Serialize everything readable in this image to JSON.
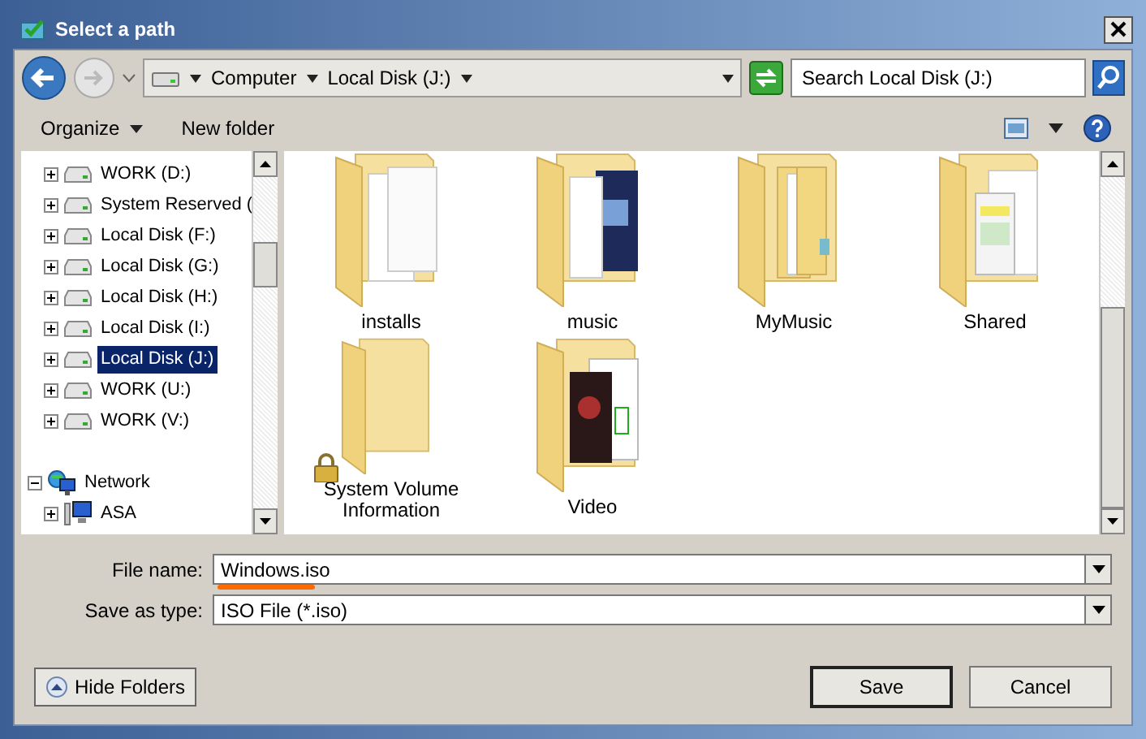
{
  "window": {
    "title": "Select a path"
  },
  "address": {
    "crumbs": [
      "Computer",
      "Local Disk (J:)"
    ]
  },
  "search": {
    "placeholder": "Search Local Disk (J:)"
  },
  "toolbar": [
    {
      "label": "Organize",
      "kind": "menu"
    },
    {
      "label": "New folder",
      "kind": "plain"
    }
  ],
  "tree": [
    {
      "children": [
        {
          "label": "WORK (D:)",
          "kind": "drive",
          "selected": false
        },
        {
          "label": "System Reserved (",
          "kind": "drive",
          "selected": false
        },
        {
          "label": "Local Disk (F:)",
          "kind": "drive",
          "selected": false
        },
        {
          "label": "Local Disk (G:)",
          "kind": "drive",
          "selected": false
        },
        {
          "label": "Local Disk (H:)",
          "kind": "drive",
          "selected": false
        },
        {
          "label": "Local Disk (I:)",
          "kind": "drive",
          "selected": false
        },
        {
          "label": "Local Disk (J:)",
          "kind": "drive",
          "selected": true
        },
        {
          "label": "WORK (U:)",
          "kind": "drive",
          "selected": false
        },
        {
          "label": "WORK (V:)",
          "kind": "drive",
          "selected": false
        }
      ]
    },
    {
      "label": "Network",
      "kind": "network",
      "selected": false,
      "expanded": true,
      "children": [
        {
          "label": "ASA",
          "kind": "computer",
          "selected": false
        }
      ]
    }
  ],
  "folders": [
    {
      "name": "installs",
      "kind": "pages",
      "locked": false
    },
    {
      "name": "music",
      "kind": "media",
      "locked": false
    },
    {
      "name": "MyMusic",
      "kind": "tabs",
      "locked": false
    },
    {
      "name": "Shared",
      "kind": "sheet",
      "locked": false
    },
    {
      "name": "System Volume Information",
      "kind": "empty",
      "locked": true
    },
    {
      "name": "Video",
      "kind": "video",
      "locked": false
    }
  ],
  "fields": [
    {
      "label": "File name:",
      "value": "Windows.iso"
    },
    {
      "label": "Save as type:",
      "value": "ISO File (*.iso)"
    }
  ],
  "hide_folders": "Hide Folders",
  "buttons": [
    {
      "label": "Save",
      "default": true
    },
    {
      "label": "Cancel",
      "default": false
    }
  ]
}
